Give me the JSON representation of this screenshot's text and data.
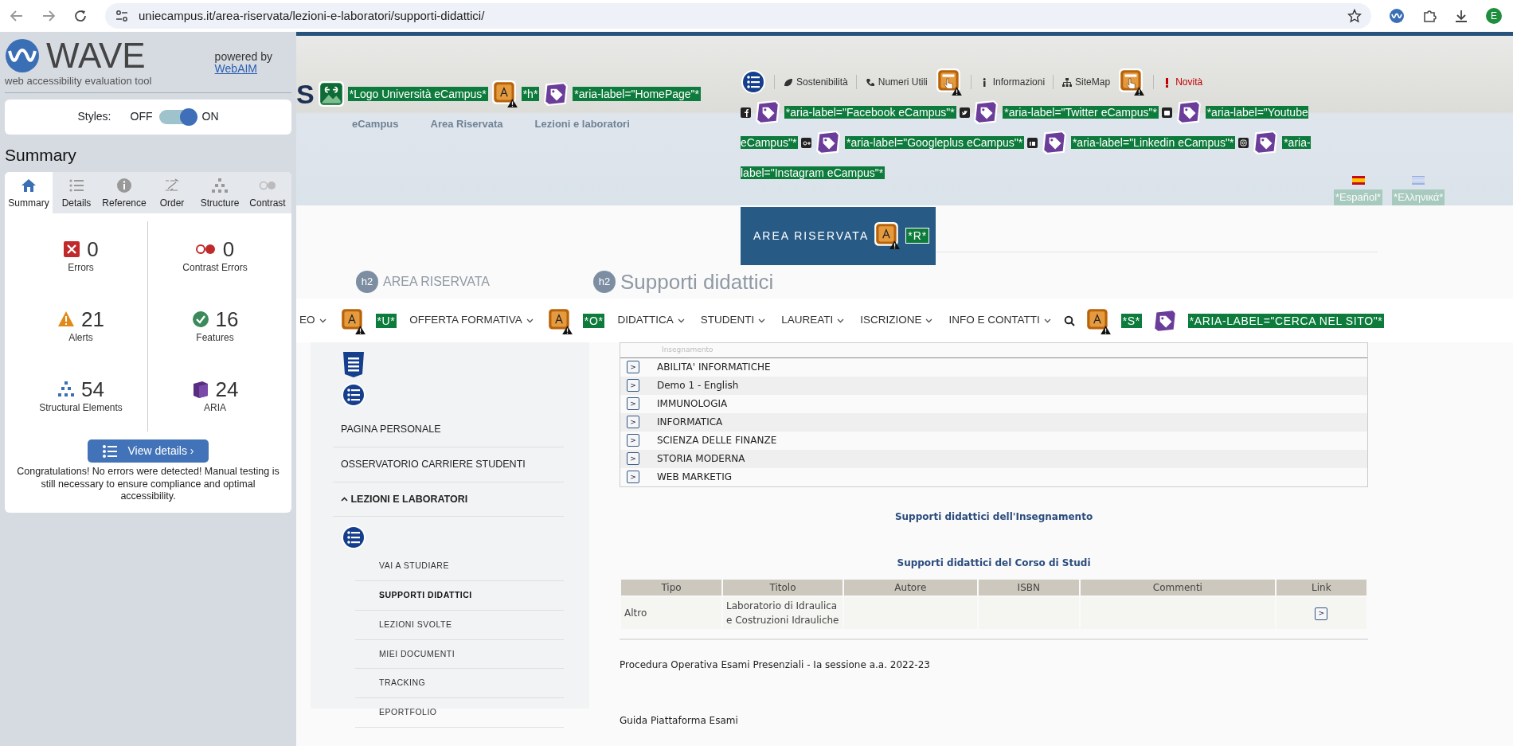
{
  "browser": {
    "url": "uniecampus.it/area-riservata/lezioni-e-laboratori/supporti-didattici/",
    "avatar": "E"
  },
  "wave": {
    "title": "WAVE",
    "subtitle": "web accessibility evaluation tool",
    "powered_by": "powered by",
    "powered_link": "WebAIM",
    "styles": {
      "label": "Styles:",
      "off": "OFF",
      "on": "ON",
      "enabled": true
    },
    "heading": "Summary",
    "tabs": [
      {
        "kind": "home",
        "label": "Summary",
        "selected": true
      },
      {
        "kind": "details",
        "label": "Details",
        "selected": false
      },
      {
        "kind": "reference",
        "label": "Reference",
        "selected": false
      },
      {
        "kind": "order",
        "label": "Order",
        "selected": false
      },
      {
        "kind": "structure",
        "label": "Structure",
        "selected": false
      },
      {
        "kind": "contrast",
        "label": "Contrast",
        "selected": false
      }
    ],
    "stats": [
      {
        "kind": "errors",
        "count": "0",
        "label": "Errors"
      },
      {
        "kind": "contrast",
        "count": "0",
        "label": "Contrast Errors"
      },
      {
        "kind": "alerts",
        "count": "21",
        "label": "Alerts"
      },
      {
        "kind": "features",
        "count": "16",
        "label": "Features"
      },
      {
        "kind": "structure",
        "count": "54",
        "label": "Structural Elements"
      },
      {
        "kind": "aria",
        "count": "24",
        "label": "ARIA"
      }
    ],
    "button": "View details ›",
    "message": "Congratulations! No errors were detected! Manual testing is still necessary to ensure compliance and optimal accessibility."
  },
  "site": {
    "logo_letter": "S",
    "logo_markers": [
      {
        "kind": "image",
        "label": "*Logo Università eCampus*"
      },
      {
        "kind": "alert",
        "label": "*h*"
      },
      {
        "kind": "aria",
        "label": "*aria-label=\"HomePage\"*"
      }
    ],
    "breadcrumbs": [
      "eCampus",
      "Area Riservata",
      "Lezioni e laboratori"
    ],
    "top_links": [
      {
        "kind": "leaf",
        "text": "Sostenibilità",
        "color": "#333333",
        "alert": false
      },
      {
        "kind": "phone",
        "text": "Numeri Utili",
        "color": "#333333",
        "alert": true
      },
      {
        "kind": "info",
        "text": "Informazioni",
        "color": "#333333",
        "alert": false
      },
      {
        "kind": "sitemap",
        "text": "SiteMap",
        "color": "#333333",
        "alert": true
      },
      {
        "kind": "exclamation",
        "text": "Novità",
        "color": "#c00000",
        "alert": false
      }
    ],
    "social": [
      {
        "kind": "facebook",
        "label": "*aria-label=\"Facebook eCampus\"*"
      },
      {
        "kind": "twitter",
        "label": "*aria-label=\"Twitter eCampus\"*"
      },
      {
        "kind": "youtube",
        "label": "*aria-label=\"Youtube eCampus\"*"
      },
      {
        "kind": "googleplus",
        "label": "*aria-label=\"Googleplus eCampus\"*"
      },
      {
        "kind": "linkedin",
        "label": "*aria-label=\"Linkedin eCampus\"*"
      },
      {
        "kind": "instagram",
        "label": "*aria-label=\"Instagram eCampus\"*"
      }
    ],
    "languages": [
      {
        "kind": "es",
        "label": "*Español*"
      },
      {
        "kind": "gr",
        "label": "*Ελληνικά*"
      }
    ],
    "area_button": {
      "text": "AREA RISERVATA",
      "label": "*R*"
    },
    "faded_headings": [
      {
        "badge": "h2",
        "text": "AREA RISERVATA"
      },
      {
        "badge": "h2",
        "text": "Supporti didattici"
      }
    ],
    "nav": [
      {
        "text": "EO",
        "alert_label": "*U*"
      },
      {
        "text": "OFFERTA FORMATIVA",
        "alert_label": "*O*"
      },
      {
        "text": "DIDATTICA"
      },
      {
        "text": "STUDENTI"
      },
      {
        "text": "LAUREATI"
      },
      {
        "text": "ISCRIZIONE"
      },
      {
        "text": "INFO E CONTATTI"
      }
    ],
    "search_markers": {
      "alert_label": "*S*",
      "aria_label": "*ARIA-LABEL=\"CERCA NEL SITO\"*"
    },
    "menu": [
      {
        "text": "PAGINA PERSONALE",
        "expanded": false
      },
      {
        "text": "OSSERVATORIO CARRIERE STUDENTI",
        "expanded": false
      },
      {
        "text": "LEZIONI E LABORATORI",
        "expanded": true,
        "children": [
          {
            "text": "VAI A STUDIARE",
            "selected": false
          },
          {
            "text": "SUPPORTI DIDATTICI",
            "selected": true
          },
          {
            "text": "LEZIONI SVOLTE",
            "selected": false
          },
          {
            "text": "MIEI DOCUMENTI",
            "selected": false
          },
          {
            "text": "TRACKING",
            "selected": false
          },
          {
            "text": "EPORTFOLIO",
            "selected": false
          }
        ]
      }
    ],
    "courses": {
      "header": "Insegnamento",
      "rows": [
        {
          "button": ">",
          "name": "ABILITA' INFORMATICHE"
        },
        {
          "button": ">",
          "name": "Demo 1 - English"
        },
        {
          "button": ">",
          "name": "IMMUNOLOGIA"
        },
        {
          "button": ">",
          "name": "INFORMATICA"
        },
        {
          "button": ">",
          "name": "SCIENZA DELLE FINANZE"
        },
        {
          "button": ">",
          "name": "STORIA MODERNA"
        },
        {
          "button": ">",
          "name": "WEB MARKETIG"
        }
      ]
    },
    "heading_course": "Supporti didattici dell'Insegnamento",
    "heading_program": "Supporti didattici del Corso di Studi",
    "table": {
      "columns": [
        "Tipo",
        "Titolo",
        "Autore",
        "ISBN",
        "Commenti",
        "Link"
      ],
      "rows": [
        {
          "tipo": "Altro",
          "titolo": "Laboratorio di Idraulica e Costruzioni Idrauliche",
          "link": ">"
        }
      ]
    },
    "paragraphs": [
      "Procedura Operativa Esami Presenziali - Ia sessione a.a. 2022-23",
      "Guida Piattaforma Esami"
    ]
  }
}
